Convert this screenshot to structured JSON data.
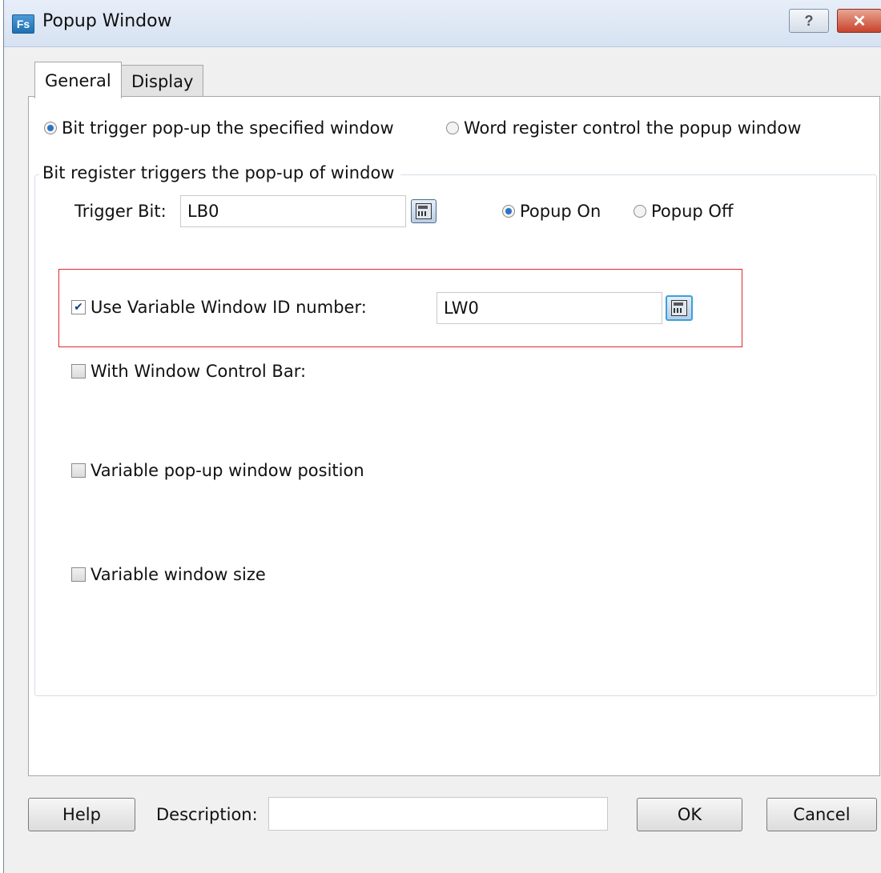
{
  "window": {
    "title": "Popup Window",
    "app_icon_text": "Fs",
    "help_button": "?",
    "close_button": "✕"
  },
  "tabs": [
    {
      "label": "General",
      "active": true
    },
    {
      "label": "Display",
      "active": false
    }
  ],
  "mode": {
    "options": [
      {
        "label": "Bit trigger pop-up the specified window",
        "selected": true
      },
      {
        "label": "Word register control the popup window",
        "selected": false
      }
    ]
  },
  "bit_group": {
    "title": "Bit register triggers the pop-up of  window",
    "trigger_bit_label": "Trigger Bit:",
    "trigger_bit_value": "LB0",
    "popup_options": [
      {
        "label": "Popup On",
        "selected": true
      },
      {
        "label": "Popup Off",
        "selected": false
      }
    ]
  },
  "options": {
    "use_variable_id": {
      "label": "Use Variable Window ID number:",
      "checked": true,
      "value": "LW0"
    },
    "control_bar": {
      "label": "With Window Control Bar:",
      "checked": false
    },
    "variable_position": {
      "label": "Variable pop-up window position",
      "checked": false
    },
    "variable_size": {
      "label": "Variable window size",
      "checked": false
    }
  },
  "footer": {
    "help_label": "Help",
    "description_label": "Description:",
    "description_value": "",
    "ok_label": "OK",
    "cancel_label": "Cancel"
  },
  "icons": {
    "calculator": "calculator-icon",
    "check": "✔"
  },
  "colors": {
    "highlight_border": "#e0292b",
    "radio_selected": "#2b73c8",
    "close_button": "#c8432c"
  }
}
